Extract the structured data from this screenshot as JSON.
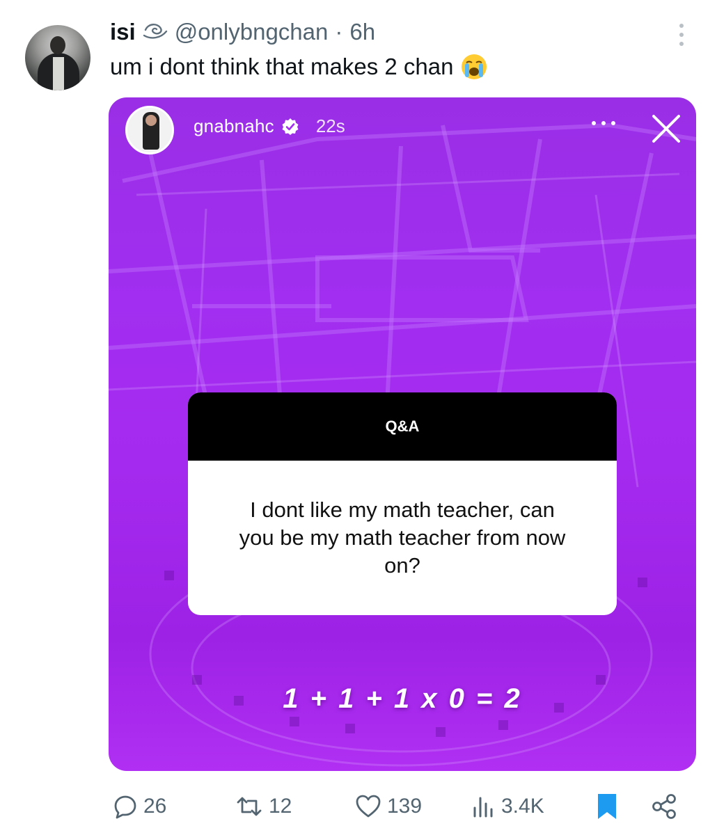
{
  "tweet": {
    "display_name": "isi",
    "handle": "@onlybngchan",
    "separator": "·",
    "time": "6h",
    "text": "um i dont think that makes 2 chan",
    "emoji_icon": "loudly-crying-face-icon"
  },
  "story": {
    "username": "gnabnahc",
    "age": "22s",
    "qa_header": "Q&A",
    "question": "I dont like my math teacher, can you be my math teacher from now on?",
    "answer": "1 + 1 + 1 x 0 = 2",
    "background_color": "#a12ef0"
  },
  "actions": {
    "replies": "26",
    "retweets": "12",
    "likes": "139",
    "views": "3.4K",
    "bookmark_color": "#1d9bf0"
  }
}
